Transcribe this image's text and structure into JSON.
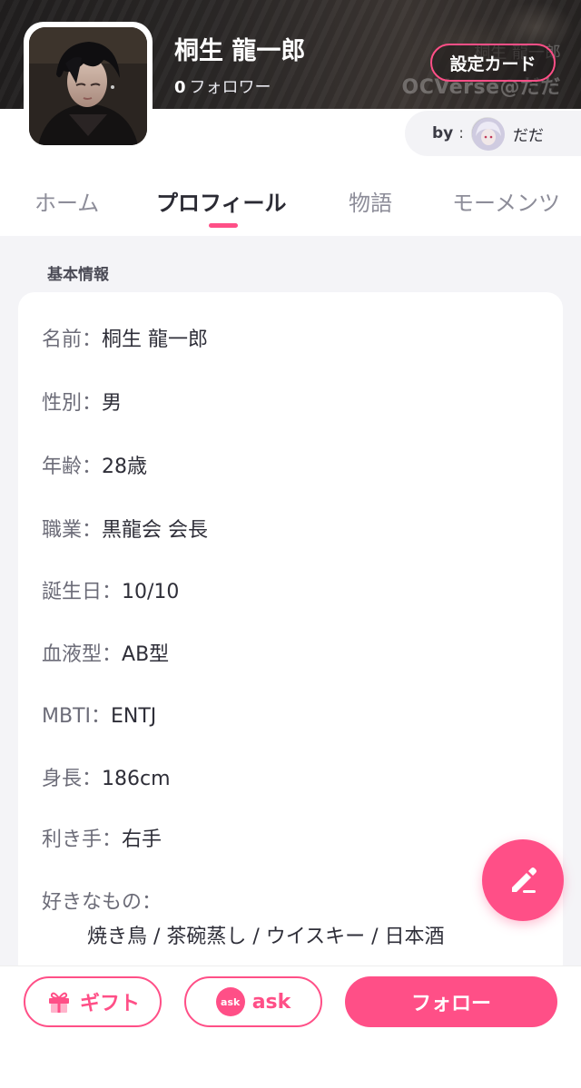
{
  "header": {
    "character_name": "桐生 龍一郎",
    "follower_count": "0",
    "follower_label": "フォロワー",
    "settings_card_label": "設定カード",
    "watermark_text": "OCVerse@だだ",
    "watermark_name": "桐生 龍一郎"
  },
  "author": {
    "by_label": "by",
    "colon": ":",
    "name": "だだ"
  },
  "tabs": [
    {
      "label": "ホーム",
      "active": false
    },
    {
      "label": "プロフィール",
      "active": true
    },
    {
      "label": "物語",
      "active": false
    },
    {
      "label": "モーメンツ",
      "active": false
    }
  ],
  "profile": {
    "section_title": "基本情報",
    "rows": [
      {
        "label": "名前：",
        "value": "桐生 龍一郎"
      },
      {
        "label": "性別：",
        "value": "男"
      },
      {
        "label": "年齢：",
        "value": "28歳"
      },
      {
        "label": "職業：",
        "value": "黒龍会 会長"
      },
      {
        "label": "誕生日：",
        "value": "10/10"
      },
      {
        "label": "血液型：",
        "value": "AB型"
      },
      {
        "label": "MBTI：",
        "value": "ENTJ"
      },
      {
        "label": "身長：",
        "value": "186cm"
      },
      {
        "label": "利き手：",
        "value": "右手"
      },
      {
        "label": "好きなもの：",
        "value": ""
      }
    ],
    "likes_value": "焼き鳥 / 茶碗蒸し / ウイスキー / 日本酒"
  },
  "actions": {
    "gift_label": "ギフト",
    "ask_label": "ask",
    "ask_icon_text": "ask",
    "follow_label": "フォロー"
  },
  "icons": {
    "gift": "gift-icon",
    "ask": "ask-icon",
    "edit": "pencil-icon"
  },
  "colors": {
    "accent": "#ff4f87",
    "banner": "#2a2726",
    "content_bg": "#f4f4f7"
  }
}
